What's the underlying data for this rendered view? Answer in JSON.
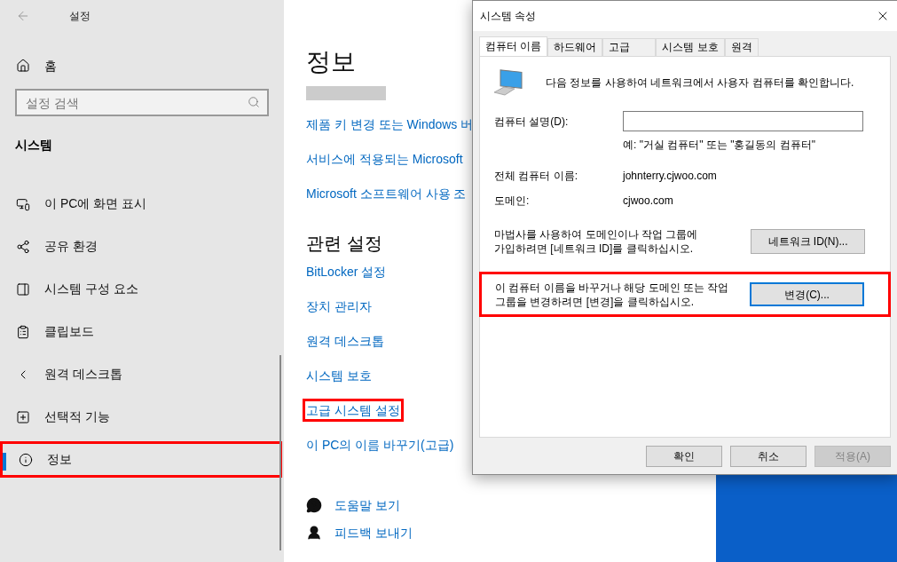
{
  "settings": {
    "title": "설정",
    "home": "홈",
    "search": {
      "placeholder": "설정 검색"
    },
    "section": "시스템",
    "nav": [
      {
        "kind": "display",
        "label": "이 PC에 화면 표시",
        "selected": false,
        "highlighted": false
      },
      {
        "kind": "share",
        "label": "공유 환경",
        "selected": false,
        "highlighted": false
      },
      {
        "kind": "components",
        "label": "시스템 구성 요소",
        "selected": false,
        "highlighted": false
      },
      {
        "kind": "clipboard",
        "label": "클립보드",
        "selected": false,
        "highlighted": false
      },
      {
        "kind": "remote",
        "label": "원격 데스크톱",
        "selected": false,
        "highlighted": false
      },
      {
        "kind": "optional",
        "label": "선택적 기능",
        "selected": false,
        "highlighted": false
      },
      {
        "kind": "about",
        "label": "정보",
        "selected": true,
        "highlighted": true
      }
    ],
    "page_title": "정보",
    "links": [
      "제품 키 변경 또는 Windows 버",
      "서비스에 적용되는 Microsoft",
      "Microsoft 소프트웨어 사용 조"
    ],
    "related": {
      "title": "관련 설정",
      "links": [
        {
          "label": "BitLocker 설정",
          "highlighted": false
        },
        {
          "label": "장치 관리자",
          "highlighted": false
        },
        {
          "label": "원격 데스크톱",
          "highlighted": false
        },
        {
          "label": "시스템 보호",
          "highlighted": false
        },
        {
          "label": "고급 시스템 설정",
          "highlighted": true
        },
        {
          "label": "이 PC의 이름 바꾸기(고급)",
          "highlighted": false
        }
      ]
    },
    "help": [
      {
        "kind": "help",
        "label": "도움말 보기"
      },
      {
        "kind": "feedback",
        "label": "피드백 보내기"
      }
    ]
  },
  "dialog": {
    "title": "시스템 속성",
    "tabs": [
      {
        "label": "컴퓨터 이름",
        "selected": true
      },
      {
        "label": "하드웨어",
        "selected": false
      },
      {
        "label": "고급",
        "selected": false
      },
      {
        "label": "시스템 보호",
        "selected": false
      },
      {
        "label": "원격",
        "selected": false
      }
    ],
    "intro": "다음 정보를 사용하여 네트워크에서 사용자 컴퓨터를 확인합니다.",
    "description_label": "컴퓨터 설명(D):",
    "hint": "예: \"거실 컴퓨터\" 또는 \"홍길동의 컴퓨터\"",
    "fields": [
      {
        "label": "전체 컴퓨터 이름:",
        "value": "johnterry.cjwoo.com"
      },
      {
        "label": "도메인:",
        "value": "cjwoo.com"
      }
    ],
    "network": {
      "text": "마법사를 사용하여 도메인이나 작업 그룹에 가입하려면 [네트워크 ID]를 클릭하십시오.",
      "button": "네트워크 ID(N)..."
    },
    "change": {
      "text": "이 컴퓨터 이름을 바꾸거나 해당 도메인 또는 작업 그룹을 변경하려면 [변경]을 클릭하십시오.",
      "button": "변경(C)...",
      "highlighted": true,
      "focused": true
    },
    "buttons": [
      {
        "label": "확인",
        "disabled": false
      },
      {
        "label": "취소",
        "disabled": false
      },
      {
        "label": "적용(A)",
        "disabled": true
      }
    ]
  }
}
